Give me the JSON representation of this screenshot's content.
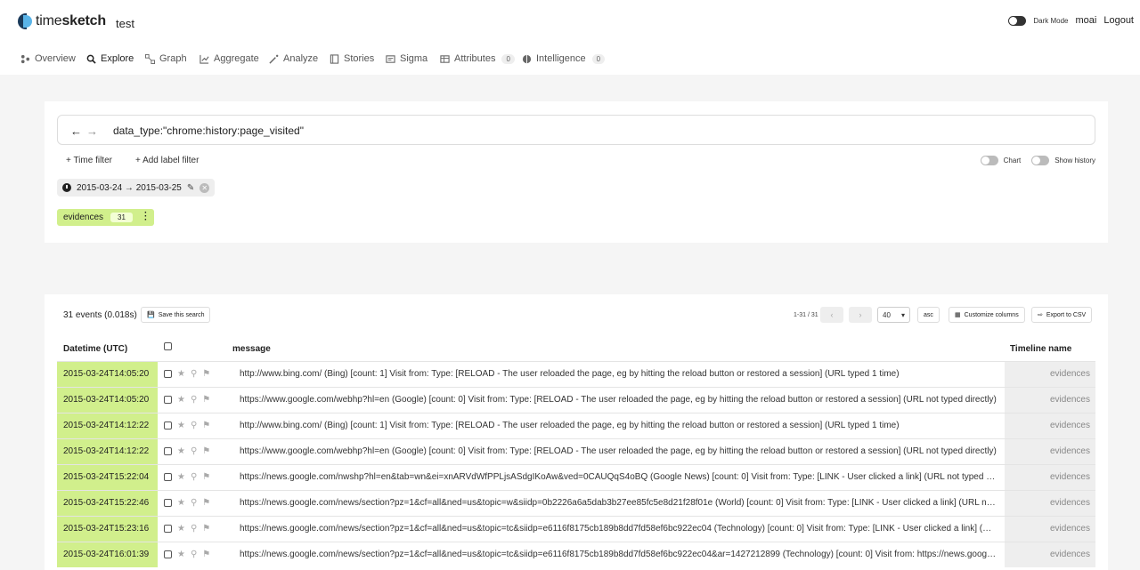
{
  "app": {
    "brand_regular": "time",
    "brand_bold": "sketch",
    "sketch_name": "test"
  },
  "topbar": {
    "dark_mode_label": "Dark Mode",
    "user": "moai",
    "logout": "Logout"
  },
  "nav": {
    "overview": "Overview",
    "explore": "Explore",
    "graph": "Graph",
    "aggregate": "Aggregate",
    "analyze": "Analyze",
    "stories": "Stories",
    "sigma": "Sigma",
    "attributes": "Attributes",
    "attributes_count": "0",
    "intelligence": "Intelligence",
    "intelligence_count": "0"
  },
  "search": {
    "query": "data_type:\"chrome:history:page_visited\"",
    "time_filter": "+ Time filter",
    "label_filter": "+ Add label filter",
    "chart_label": "Chart",
    "history_label": "Show history",
    "date_range": "2015-03-24 → 2015-03-25",
    "timeline_name": "evidences",
    "timeline_count": "31"
  },
  "results": {
    "count_text": "31 events (0.018s)",
    "save_search": "Save this search",
    "pager_text": "1-31 / 31",
    "page_size": "40",
    "order": "asc",
    "customize_columns": "Customize columns",
    "export_csv": "Export to CSV",
    "columns": {
      "datetime": "Datetime (UTC)",
      "message": "message",
      "timeline": "Timeline name"
    },
    "rows": [
      {
        "datetime": "2015-03-24T14:05:20",
        "message": "http://www.bing.com/ (Bing) [count: 1] Visit from: Type: [RELOAD - The user reloaded the page, eg by hitting the reload button or restored a session] (URL typed 1 time)",
        "timeline": "evidences"
      },
      {
        "datetime": "2015-03-24T14:05:20",
        "message": "https://www.google.com/webhp?hl=en (Google) [count: 0] Visit from: Type: [RELOAD - The user reloaded the page, eg by hitting the reload button or restored a session] (URL not typed directly)",
        "timeline": "evidences"
      },
      {
        "datetime": "2015-03-24T14:12:22",
        "message": "http://www.bing.com/ (Bing) [count: 1] Visit from: Type: [RELOAD - The user reloaded the page, eg by hitting the reload button or restored a session] (URL typed 1 time)",
        "timeline": "evidences"
      },
      {
        "datetime": "2015-03-24T14:12:22",
        "message": "https://www.google.com/webhp?hl=en (Google) [count: 0] Visit from: Type: [RELOAD - The user reloaded the page, eg by hitting the reload button or restored a session] (URL not typed directly)",
        "timeline": "evidences"
      },
      {
        "datetime": "2015-03-24T15:22:04",
        "message": "https://news.google.com/nwshp?hl=en&tab=wn&ei=xnARVdWfPPLjsASdgIKoAw&ved=0CAUQqS4oBQ (Google News) [count: 0] Visit from: Type: [LINK - User clicked a link] (URL not typed directly)",
        "timeline": "evidences"
      },
      {
        "datetime": "2015-03-24T15:22:46",
        "message": "https://news.google.com/news/section?pz=1&cf=all&ned=us&topic=w&siidp=0b2226a6a5dab3b27ee85fc5e8d21f28f01e (World) [count: 0] Visit from: Type: [LINK - User clicked a link] (URL not typed directly)",
        "timeline": "evidences"
      },
      {
        "datetime": "2015-03-24T15:23:16",
        "message": "https://news.google.com/news/section?pz=1&cf=all&ned=us&topic=tc&siidp=e6116f8175cb189b8dd7fd58ef6bc922ec04 (Technology) [count: 0] Visit from: Type: [LINK - User clicked a link] (URL not typed directly)",
        "timeline": "evidences"
      },
      {
        "datetime": "2015-03-24T16:01:39",
        "message": "https://news.google.com/news/section?pz=1&cf=all&ned=us&topic=tc&siidp=e6116f8175cb189b8dd7fd58ef6bc922ec04&ar=1427212899 (Technology) [count: 0] Visit from: https://news.google.com/news/section",
        "timeline": "evidences"
      }
    ]
  }
}
